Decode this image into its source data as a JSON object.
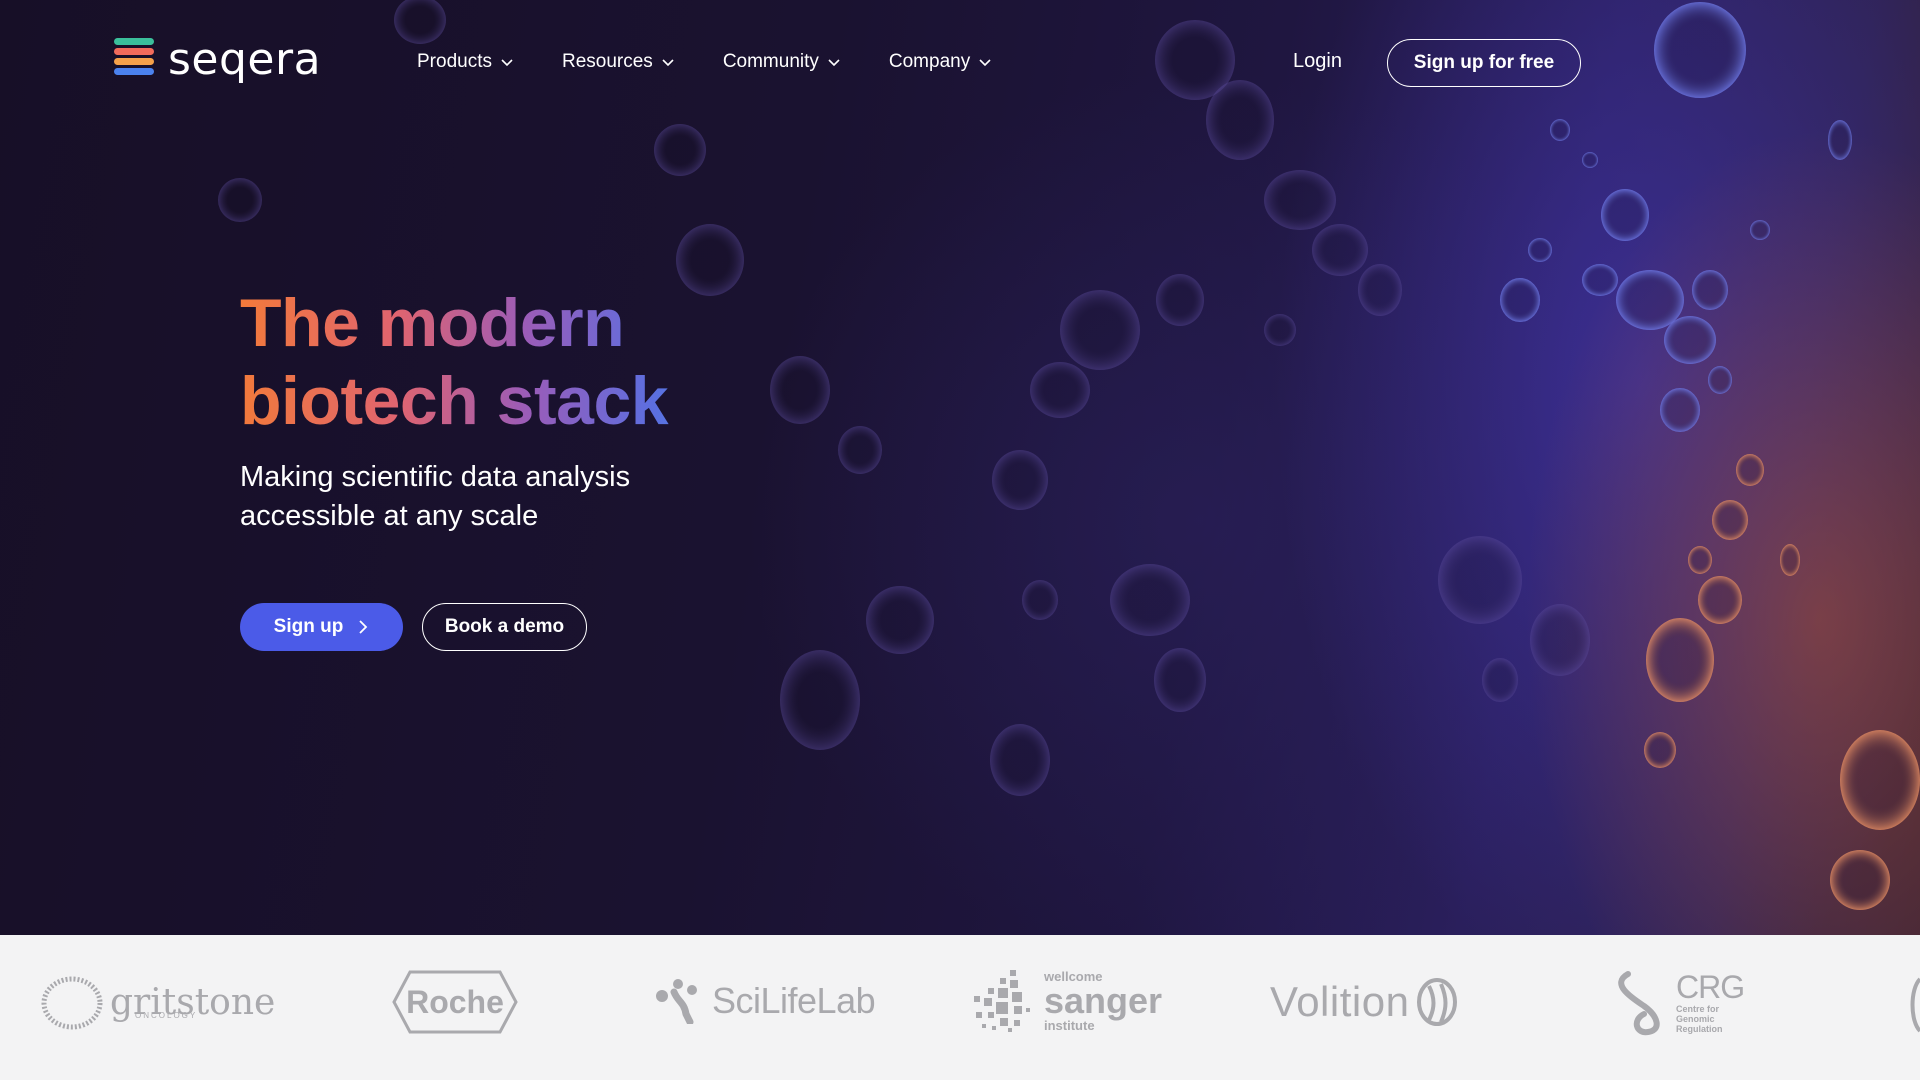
{
  "brand": {
    "name": "seqera"
  },
  "nav": {
    "items": [
      {
        "label": "Products"
      },
      {
        "label": "Resources"
      },
      {
        "label": "Community"
      },
      {
        "label": "Company"
      }
    ],
    "login_label": "Login",
    "signup_free_label": "Sign up for free"
  },
  "hero": {
    "headline_line1": "The modern",
    "headline_line2": "biotech stack",
    "subheadline": "Making scientific data analysis accessible at any scale",
    "primary_cta": "Sign up",
    "secondary_cta": "Book a demo"
  },
  "partners": {
    "gritstone": {
      "name": "gritstone",
      "sub": "ONCOLOGY"
    },
    "roche": {
      "name": "Roche"
    },
    "scilifelab": {
      "name": "SciLifeLab"
    },
    "sanger": {
      "top": "wellcome",
      "name": "sanger",
      "bottom": "institute"
    },
    "volition": {
      "name": "Volition"
    },
    "crg": {
      "name": "CRG",
      "desc": "Centre for Genomic Regulation"
    }
  },
  "colors": {
    "accent": "#4b5be8",
    "hero_bg": "#1a1230",
    "logo_strip_bg": "#f3f3f4",
    "partner_gray": "#a9a9ad"
  }
}
